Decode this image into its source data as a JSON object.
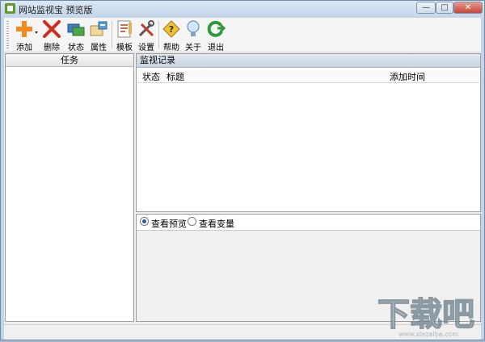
{
  "window": {
    "title": "网站监视宝 预览版",
    "controls": {
      "minimize": "—",
      "maximize": "□",
      "close": "✕"
    }
  },
  "toolbar": {
    "buttons": [
      {
        "id": "add",
        "label": "添加",
        "icon": "plus-icon"
      },
      {
        "id": "delete",
        "label": "删除",
        "icon": "x-icon"
      },
      {
        "id": "status",
        "label": "状态",
        "icon": "status-icon"
      },
      {
        "id": "properties",
        "label": "属性",
        "icon": "properties-icon"
      },
      {
        "id": "template",
        "label": "模板",
        "icon": "template-icon"
      },
      {
        "id": "settings",
        "label": "设置",
        "icon": "tools-icon"
      },
      {
        "id": "help",
        "label": "帮助",
        "icon": "help-icon"
      },
      {
        "id": "about",
        "label": "关于",
        "icon": "bulb-icon"
      },
      {
        "id": "exit",
        "label": "退出",
        "icon": "exit-icon"
      }
    ]
  },
  "task_panel": {
    "header": "任务"
  },
  "monitor_panel": {
    "header": "监视记录",
    "columns": [
      "状态",
      "标题",
      "添加时间"
    ]
  },
  "preview_panel": {
    "options": [
      {
        "label": "查看预览",
        "selected": true
      },
      {
        "label": "查看变量",
        "selected": false
      }
    ]
  },
  "watermark": {
    "text": "下载吧",
    "sub": "www.xiazaiba.com"
  },
  "colors": {
    "frame": "#c3d4e6",
    "accent": "#2456a6",
    "header_blue": "#c9d4e0"
  }
}
